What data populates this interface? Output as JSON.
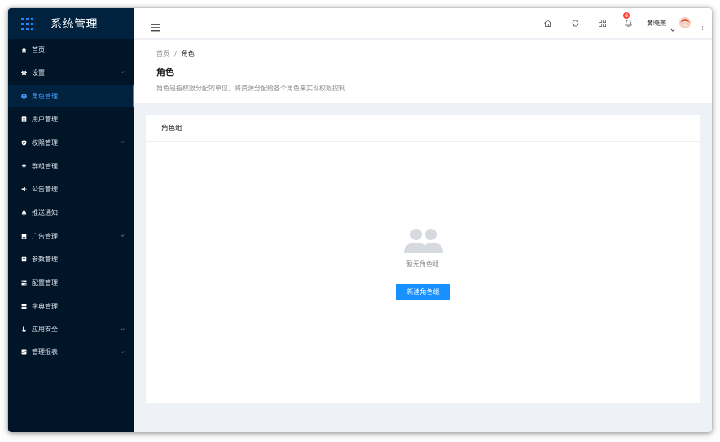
{
  "app": {
    "title": "系统管理"
  },
  "sidebar": {
    "items": [
      {
        "label": "首页",
        "icon": "home-icon"
      },
      {
        "label": "设置",
        "icon": "gear-icon",
        "has_arrow": true
      },
      {
        "label": "角色管理",
        "icon": "user-circle-icon",
        "active": true
      },
      {
        "label": "用户管理",
        "icon": "id-card-icon"
      },
      {
        "label": "权限管理",
        "icon": "shield-check-icon",
        "has_arrow": true
      },
      {
        "label": "群组管理",
        "icon": "users-icon"
      },
      {
        "label": "公告管理",
        "icon": "megaphone-icon"
      },
      {
        "label": "推送通知",
        "icon": "bell-icon"
      },
      {
        "label": "广告管理",
        "icon": "ad-icon",
        "has_arrow": true
      },
      {
        "label": "参数管理",
        "icon": "sliders-icon"
      },
      {
        "label": "配置管理",
        "icon": "config-icon"
      },
      {
        "label": "字典管理",
        "icon": "dictionary-icon"
      },
      {
        "label": "应用安全",
        "icon": "hand-pointer-icon",
        "has_arrow": true
      },
      {
        "label": "管理报表",
        "icon": "chart-icon",
        "has_arrow": true
      }
    ]
  },
  "header": {
    "notification_count": "6",
    "user_name": "黄晓燕"
  },
  "breadcrumb": {
    "home": "首页",
    "separator": "/",
    "current": "角色"
  },
  "page": {
    "title": "角色",
    "description": "角色是指权限分配的单位，将资源分配给各个角色来实现权限控制"
  },
  "card": {
    "title": "角色组",
    "empty_text": "暂无角色组",
    "new_button": "新建角色组"
  },
  "colors": {
    "sidebar_bg": "#011529",
    "logo_bg": "#00223f",
    "primary": "#1890ff",
    "badge": "#ff3b30",
    "page_bg": "#eef1f5"
  }
}
